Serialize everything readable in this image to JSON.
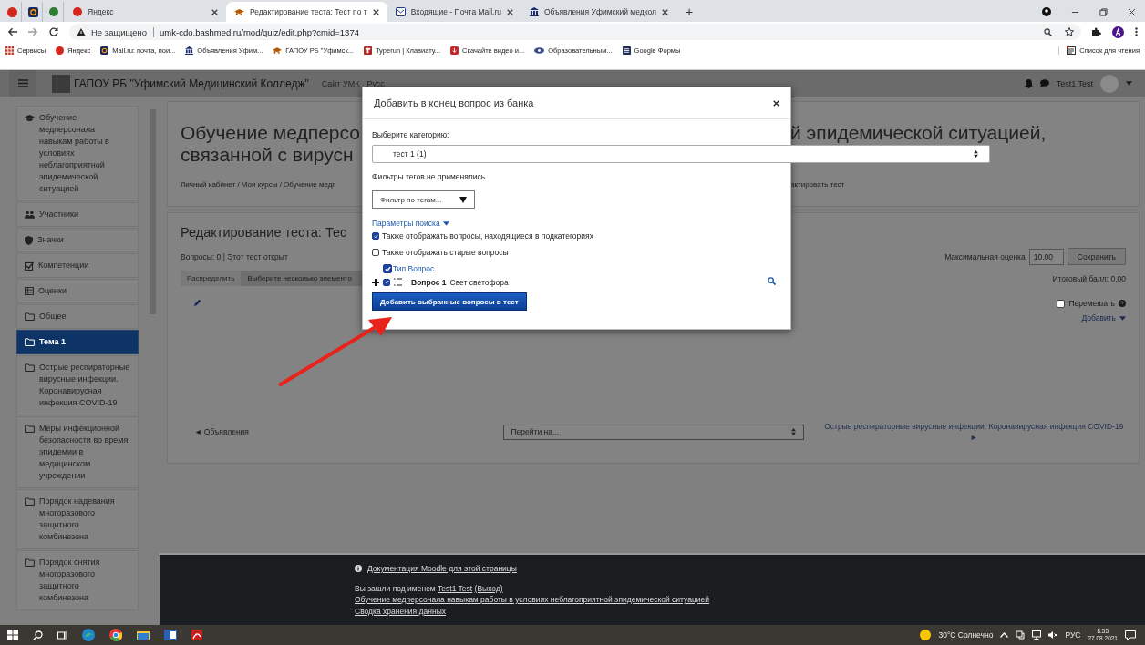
{
  "browser": {
    "tabs": [
      {
        "label": "Яндекс",
        "selected": false
      },
      {
        "label": "Редактирование теста: Тест по т",
        "selected": true
      },
      {
        "label": "Входящие - Почта Mail.ru",
        "selected": false
      },
      {
        "label": "Объявления Уфимский медкол",
        "selected": false
      }
    ],
    "new_tab": "+",
    "address": {
      "security": "Не защищено",
      "url": "umk-cdo.bashmed.ru/mod/quiz/edit.php?cmid=1374"
    },
    "bookmarks": [
      "Сервисы",
      "Яндекс",
      "Mail.ru: почта, пои...",
      "Объявления Уфим...",
      "ГАПОУ РБ \"Уфимск...",
      "Typerun | Клавиату...",
      "Скачайте видео и...",
      "Образовательным...",
      "Google Формы"
    ],
    "reading_list": "Список для чтения"
  },
  "navbar": {
    "site_name": "ГАПОУ РБ \"Уфимский Медицинский Колледж\"",
    "links": [
      "Сайт УМК",
      "Русс"
    ],
    "user": "Test1 Test"
  },
  "sidebar": {
    "items": [
      {
        "kind": "course",
        "label": "Обучение медперсонала навыкам работы в условиях неблагоприятной эпидемической ситуацией",
        "selected": false
      },
      {
        "kind": "users",
        "label": "Участники",
        "selected": false
      },
      {
        "kind": "badges",
        "label": "Значки",
        "selected": false
      },
      {
        "kind": "competencies",
        "label": "Компетенции",
        "selected": false
      },
      {
        "kind": "grades",
        "label": "Оценки",
        "selected": false
      },
      {
        "kind": "folder",
        "label": "Общее",
        "selected": false
      },
      {
        "kind": "folder",
        "label": "Тема 1",
        "selected": true
      },
      {
        "kind": "folder",
        "label": "Острые респираторные вирусные инфекции. Коронавирусная инфекция COVID-19",
        "selected": false
      },
      {
        "kind": "folder",
        "label": "Меры инфекционной безопасности во время эпидемии в медицинском учреждении",
        "selected": false
      },
      {
        "kind": "folder",
        "label": "Порядок надевания многоразового защитного комбинезона",
        "selected": false
      },
      {
        "kind": "folder",
        "label": "Порядок снятия многоразового защитного комбинезона",
        "selected": false
      }
    ]
  },
  "course_header": {
    "title_left": [
      "Обучение медперсо",
      "связанной с вирусн"
    ],
    "title_right": "й эпидемической ситуацией,",
    "breadcrumb_left": "Личный кабинет / Мои курсы / Обучение медп",
    "breadcrumb_right": "актировать тест"
  },
  "quiz": {
    "title": "Редактирование теста: Тес",
    "status": "Вопросы: 0 | Этот тест открыт",
    "max_grade_label": "Максимальная оценка",
    "max_grade": "10.00",
    "save": "Сохранить",
    "toolbar": [
      "Распределить",
      "Выберите несколько элементо"
    ],
    "total": "Итоговый балл: 0,00",
    "shuffle": {
      "label": "Перемешать",
      "checked": false
    },
    "add": "Добавить"
  },
  "navigation": {
    "previous": "◄ Объявления",
    "jump": "Перейти на...",
    "next": "Острые респираторные вирусные инфекции. Коронавирусная инфекция COVID-19 ►"
  },
  "modal": {
    "title": "Добавить в конец вопрос из банка",
    "category_label": "Выберите категорию:",
    "category": "тест 1 (1)",
    "tag_status": "Фильтры тегов не применялись",
    "tag_filter": {
      "placeholder": "Фильтр по тегам..."
    },
    "search_options": "Параметры поиска",
    "options": [
      {
        "label": "Также отображать вопросы, находящиеся в подкатегориях",
        "checked": true
      },
      {
        "label": "Также отображать старые вопросы",
        "checked": false
      }
    ],
    "select_all": {
      "label": "Тип Вопрос",
      "checked": true
    },
    "questions": [
      {
        "name": "Вопрос 1",
        "text": "Свет светофора",
        "checked": true
      }
    ],
    "submit": "Добавить выбранные вопросы в тест"
  },
  "footer": {
    "doc_link": "Документация Moodle для этой страницы",
    "login_prefix": "Вы зашли под именем",
    "user": "Test1 Test",
    "logout": "(Выход)",
    "links": [
      "Обучение медперсонала навыкам работы в условиях неблагоприятной эпидемической ситуацией",
      "Сводка хранения данных"
    ]
  },
  "taskbar": {
    "weather": "30°C Солнечно",
    "language": "РУС",
    "time": "8:55",
    "date": "27.08.2021"
  }
}
